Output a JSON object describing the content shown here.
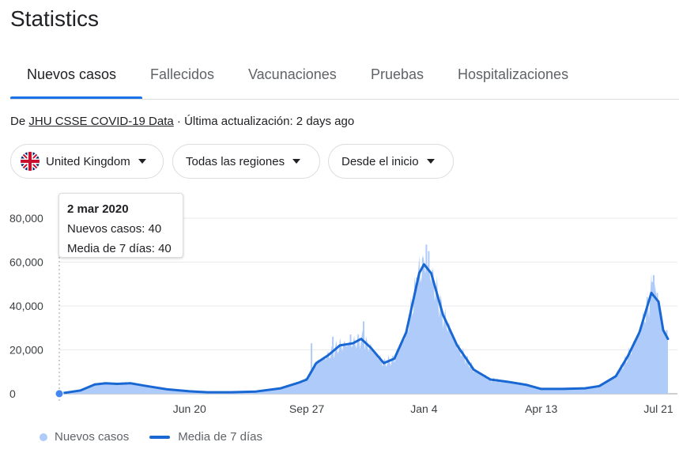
{
  "title": "Statistics",
  "tabs": [
    {
      "label": "Nuevos casos",
      "active": true
    },
    {
      "label": "Fallecidos",
      "active": false
    },
    {
      "label": "Vacunaciones",
      "active": false
    },
    {
      "label": "Pruebas",
      "active": false
    },
    {
      "label": "Hospitalizaciones",
      "active": false
    }
  ],
  "source": {
    "prefix": "De",
    "link": "JHU CSSE COVID-19 Data",
    "suffix": " · Última actualización: 2 days ago"
  },
  "filters": {
    "country": "United Kingdom",
    "region": "Todas las regiones",
    "range": "Desde el inicio",
    "flag_icon": "uk-flag-icon"
  },
  "tooltip": {
    "date": "2 mar 2020",
    "cases": "Nuevos casos: 40",
    "average": "Media de 7 días: 40"
  },
  "legend": {
    "cases": "Nuevos casos",
    "average": "Media de 7 días"
  },
  "colors": {
    "accent": "#1a73e8",
    "bars": "#aecbfa",
    "line": "#1967d2"
  },
  "chart_data": {
    "type": "area",
    "ylim": [
      0,
      80000
    ],
    "yticks": [
      0,
      20000,
      40000,
      60000,
      80000
    ],
    "ytick_labels": [
      "0",
      "20,000",
      "40,000",
      "60,000",
      "80,000"
    ],
    "xticks": [
      {
        "date": "2020-06-20",
        "label": "Jun 20"
      },
      {
        "date": "2020-09-27",
        "label": "Sep 27"
      },
      {
        "date": "2021-01-04",
        "label": "Jan 4"
      },
      {
        "date": "2021-04-13",
        "label": "Apr 13"
      },
      {
        "date": "2021-07-21",
        "label": "Jul 21"
      }
    ],
    "x_start": "2020-03-02",
    "x_end": "2021-07-29",
    "grid": true,
    "legend_position": "bottom-left",
    "series": [
      {
        "name": "Media de 7 días",
        "points": [
          [
            "2020-03-02",
            40
          ],
          [
            "2020-03-20",
            1500
          ],
          [
            "2020-04-01",
            4200
          ],
          [
            "2020-04-10",
            4800
          ],
          [
            "2020-04-20",
            4500
          ],
          [
            "2020-05-01",
            4800
          ],
          [
            "2020-05-15",
            3500
          ],
          [
            "2020-06-01",
            2000
          ],
          [
            "2020-06-20",
            1100
          ],
          [
            "2020-07-05",
            700
          ],
          [
            "2020-07-25",
            700
          ],
          [
            "2020-08-15",
            1000
          ],
          [
            "2020-09-05",
            2500
          ],
          [
            "2020-09-20",
            5000
          ],
          [
            "2020-09-27",
            6500
          ],
          [
            "2020-10-05",
            14000
          ],
          [
            "2020-10-15",
            17500
          ],
          [
            "2020-10-25",
            22000
          ],
          [
            "2020-11-05",
            23000
          ],
          [
            "2020-11-12",
            25000
          ],
          [
            "2020-11-20",
            21000
          ],
          [
            "2020-12-01",
            14000
          ],
          [
            "2020-12-10",
            16000
          ],
          [
            "2020-12-20",
            28000
          ],
          [
            "2020-12-31",
            55000
          ],
          [
            "2021-01-04",
            59000
          ],
          [
            "2021-01-10",
            55000
          ],
          [
            "2021-01-20",
            36000
          ],
          [
            "2021-02-01",
            22000
          ],
          [
            "2021-02-15",
            11000
          ],
          [
            "2021-03-01",
            6500
          ],
          [
            "2021-03-15",
            5500
          ],
          [
            "2021-04-01",
            4000
          ],
          [
            "2021-04-13",
            2200
          ],
          [
            "2021-05-01",
            2200
          ],
          [
            "2021-05-20",
            2500
          ],
          [
            "2021-06-01",
            3500
          ],
          [
            "2021-06-15",
            8000
          ],
          [
            "2021-06-25",
            17000
          ],
          [
            "2021-07-05",
            28000
          ],
          [
            "2021-07-15",
            46000
          ],
          [
            "2021-07-21",
            42000
          ],
          [
            "2021-07-25",
            29000
          ],
          [
            "2021-07-29",
            25000
          ]
        ]
      },
      {
        "name": "Nuevos casos",
        "spikes": [
          [
            "2020-10-01",
            23000
          ],
          [
            "2020-10-19",
            26000
          ],
          [
            "2020-11-03",
            27000
          ],
          [
            "2020-11-14",
            33000
          ],
          [
            "2020-12-29",
            53000
          ],
          [
            "2021-01-03",
            62000
          ],
          [
            "2021-01-06",
            68000
          ],
          [
            "2021-01-08",
            65000
          ],
          [
            "2021-07-16",
            51000
          ],
          [
            "2021-07-17",
            54000
          ],
          [
            "2021-07-20",
            46000
          ],
          [
            "2021-07-28",
            29000
          ]
        ]
      }
    ]
  }
}
